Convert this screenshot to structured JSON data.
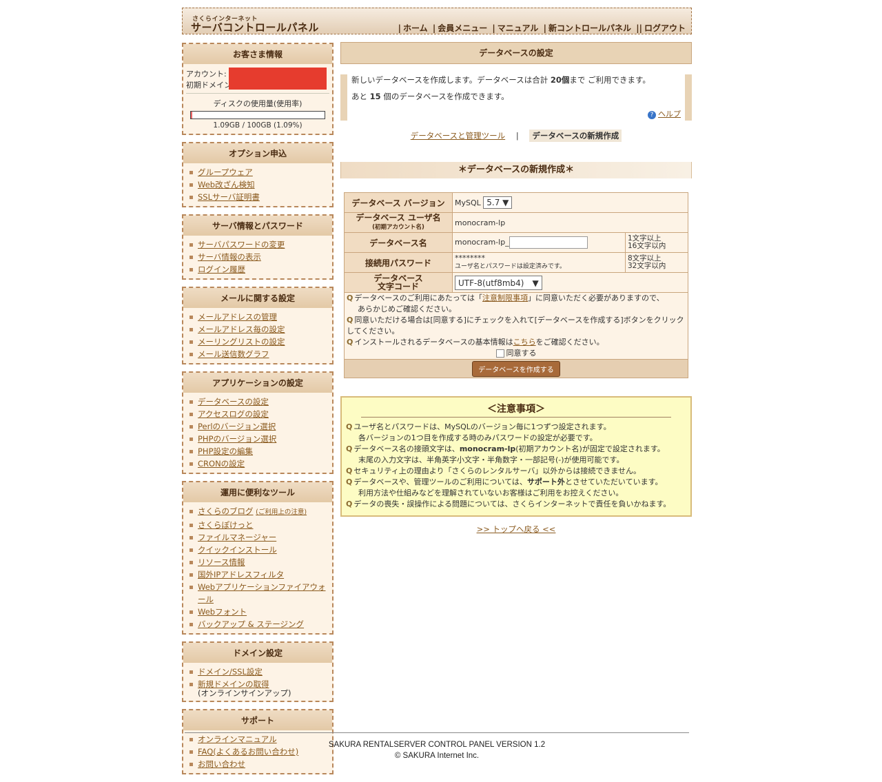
{
  "header": {
    "logo_small": "さくらインターネット",
    "logo_big": "サーバコントロールパネル",
    "nav": [
      "ホーム",
      "会員メニュー",
      "マニュアル",
      "新コントロールパネル",
      "ログアウト"
    ]
  },
  "customer": {
    "title": "お客さま情報",
    "account_label": "アカウント:",
    "domain_label": "初期ドメイン:",
    "disk_label": "ディスクの使用量(使用率)",
    "disk_value": "1.09GB / 100GB (1.09%)",
    "disk_ratio": 0.0109
  },
  "sidebar": {
    "option": {
      "title": "オプション申込",
      "items": [
        "グループウェア",
        "Web改ざん検知",
        "SSLサーバ証明書"
      ]
    },
    "server": {
      "title": "サーバ情報とパスワード",
      "items": [
        "サーバパスワードの変更",
        "サーバ情報の表示",
        "ログイン履歴"
      ]
    },
    "mail": {
      "title": "メールに関する設定",
      "items": [
        "メールアドレスの管理",
        "メールアドレス毎の設定",
        "メーリングリストの設定",
        "メール送信数グラフ"
      ]
    },
    "app": {
      "title": "アプリケーションの設定",
      "items": [
        "データベースの設定",
        "アクセスログの設定",
        "Perlのバージョン選択",
        "PHPのバージョン選択",
        "PHP設定の編集",
        "CRONの設定"
      ]
    },
    "tools": {
      "title": "運用に便利なツール",
      "items": [
        "さくらのブログ",
        "さくらぽけっと",
        "ファイルマネージャー",
        "クイックインストール",
        "リソース情報",
        "国外IPアドレスフィルタ",
        "Webアプリケーションファイアウォール",
        "Webフォント",
        "バックアップ & ステージング"
      ],
      "blog_note": "(ご利用上の注意)"
    },
    "domain": {
      "title": "ドメイン設定",
      "items": [
        "ドメイン/SSL設定",
        "新規ドメインの取得"
      ],
      "signup_note": "(オンラインサインアップ)"
    },
    "support": {
      "title": "サポート",
      "items": [
        "オンラインマニュアル",
        "FAQ(よくあるお問い合わせ)",
        "お問い合わせ"
      ]
    }
  },
  "main": {
    "title": "データベースの設定",
    "intro1_pre": "新しいデータベースを作成します。データベースは合計",
    "intro1_num": "20個",
    "intro1_post": "まで ご利用できます。",
    "intro2_pre": "あと",
    "intro2_num": "15",
    "intro2_post": "個のデータベースを作成できます。",
    "help": "ヘルプ",
    "tab_tools": "データベースと管理ツール",
    "tab_sep": "|",
    "tab_new": "データベースの新規作成",
    "section_title": "＊データベースの新規作成＊"
  },
  "form": {
    "version_label": "データベース バージョン",
    "version_prefix": "MySQL",
    "version_value": "5.7 ▼",
    "user_label": "データベース ユーザ名",
    "user_sub": "(初期アカウント名)",
    "user_value": "monocram-lp",
    "name_label": "データベース名",
    "name_prefix": "monocram-lp_",
    "name_note1": "1文字以上",
    "name_note2": "16文字以内",
    "pw_label": "接続用パスワード",
    "pw_value": "********",
    "pw_sub": "ユーザ名とパスワードは設定済みです。",
    "pw_note1": "8文字以上",
    "pw_note2": "32文字以内",
    "charset_label1": "データベース",
    "charset_label2": "文字コード",
    "charset_value": "UTF-8(utf8mb4)　▼",
    "agree1_pre": "データベースのご利用にあたっては「",
    "agree1_link": "注意制限事項",
    "agree1_post": "」に同意いただく必要がありますので、",
    "agree1_line2": "あらかじめご確認ください。",
    "agree2": "同意いただける場合は[同意する]にチェックを入れて[データベースを作成する]ボタンをクリックしてください。",
    "agree3_pre": "インストールされるデータベースの基本情報は",
    "agree3_link": "こちら",
    "agree3_post": "をご確認ください。",
    "agree_checkbox": "同意する",
    "submit": "データベースを作成する"
  },
  "caution": {
    "title": "＜注意事項＞",
    "l1": "ユーザ名とパスワードは、MySQLのバージョン毎に1つずつ設定されます。",
    "l1b": "各バージョンの1つ目を作成する時のみパスワードの設定が必要です。",
    "l2_pre": "データベース名の接頭文字は、",
    "l2_bold": "monocram-lp",
    "l2_post": "(初期アカウント名)が固定で設定されます。",
    "l2b": "末尾の入力文字は、半角英字小文字・半角数字・一部記号(-)が使用可能です。",
    "l3": "セキュリティ上の理由より「さくらのレンタルサーバ」以外からは接続できません。",
    "l4_pre": "データベースや、管理ツールのご利用については、",
    "l4_bold": "サポート外",
    "l4_post": "とさせていただいています。",
    "l4b": "利用方法や仕組みなどを理解されていないお客様はご利用をお控えください。",
    "l5": "データの喪失・誤操作による問題については、さくらインターネットで責任を負いかねます。"
  },
  "totop": ">> トップへ戻る <<",
  "footer": {
    "version": "SAKURA RENTALSERVER CONTROL PANEL VERSION 1.2",
    "copyright": "© SAKURA Internet Inc."
  }
}
